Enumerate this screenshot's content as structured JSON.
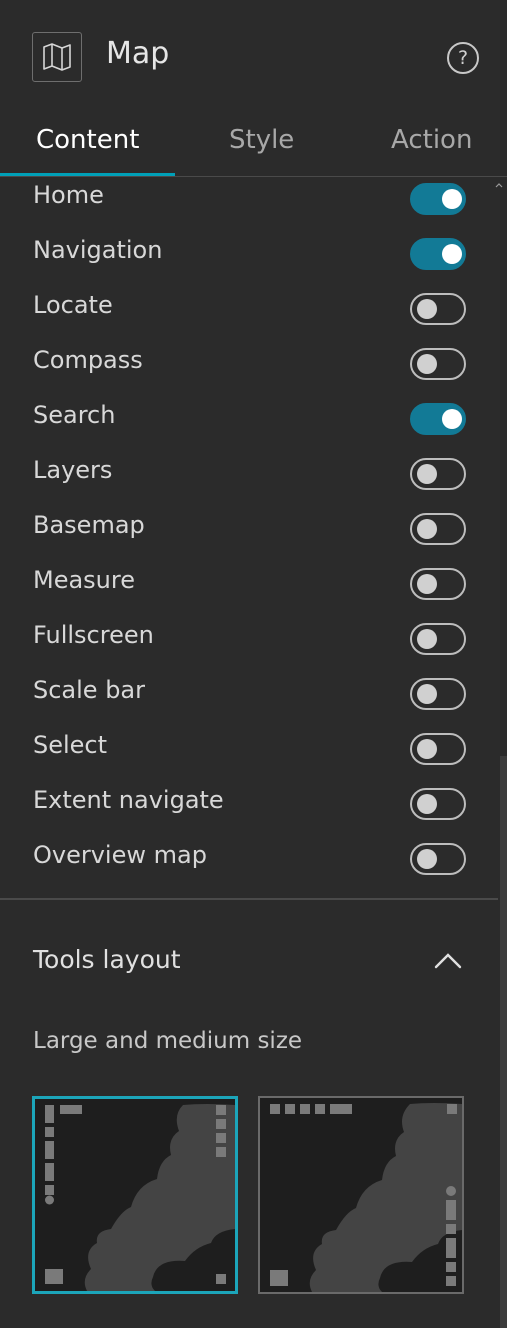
{
  "header": {
    "title": "Map",
    "help_glyph": "?"
  },
  "tabs": [
    {
      "label": "Content",
      "active": true
    },
    {
      "label": "Style",
      "active": false
    },
    {
      "label": "Action",
      "active": false
    }
  ],
  "tools": [
    {
      "label": "Home",
      "on": true
    },
    {
      "label": "Navigation",
      "on": true
    },
    {
      "label": "Locate",
      "on": false
    },
    {
      "label": "Compass",
      "on": false
    },
    {
      "label": "Search",
      "on": true
    },
    {
      "label": "Layers",
      "on": false
    },
    {
      "label": "Basemap",
      "on": false
    },
    {
      "label": "Measure",
      "on": false
    },
    {
      "label": "Fullscreen",
      "on": false
    },
    {
      "label": "Scale bar",
      "on": false
    },
    {
      "label": "Select",
      "on": false
    },
    {
      "label": "Extent navigate",
      "on": false
    },
    {
      "label": "Overview map",
      "on": false
    }
  ],
  "tools_layout": {
    "title": "Tools layout",
    "subtitle": "Large and medium size",
    "options": [
      {
        "name": "layout-left",
        "selected": true
      },
      {
        "name": "layout-top",
        "selected": false
      }
    ]
  },
  "colors": {
    "accent": "#1ca5ba",
    "toggle_on": "#127a96",
    "background": "#2b2b2b"
  }
}
